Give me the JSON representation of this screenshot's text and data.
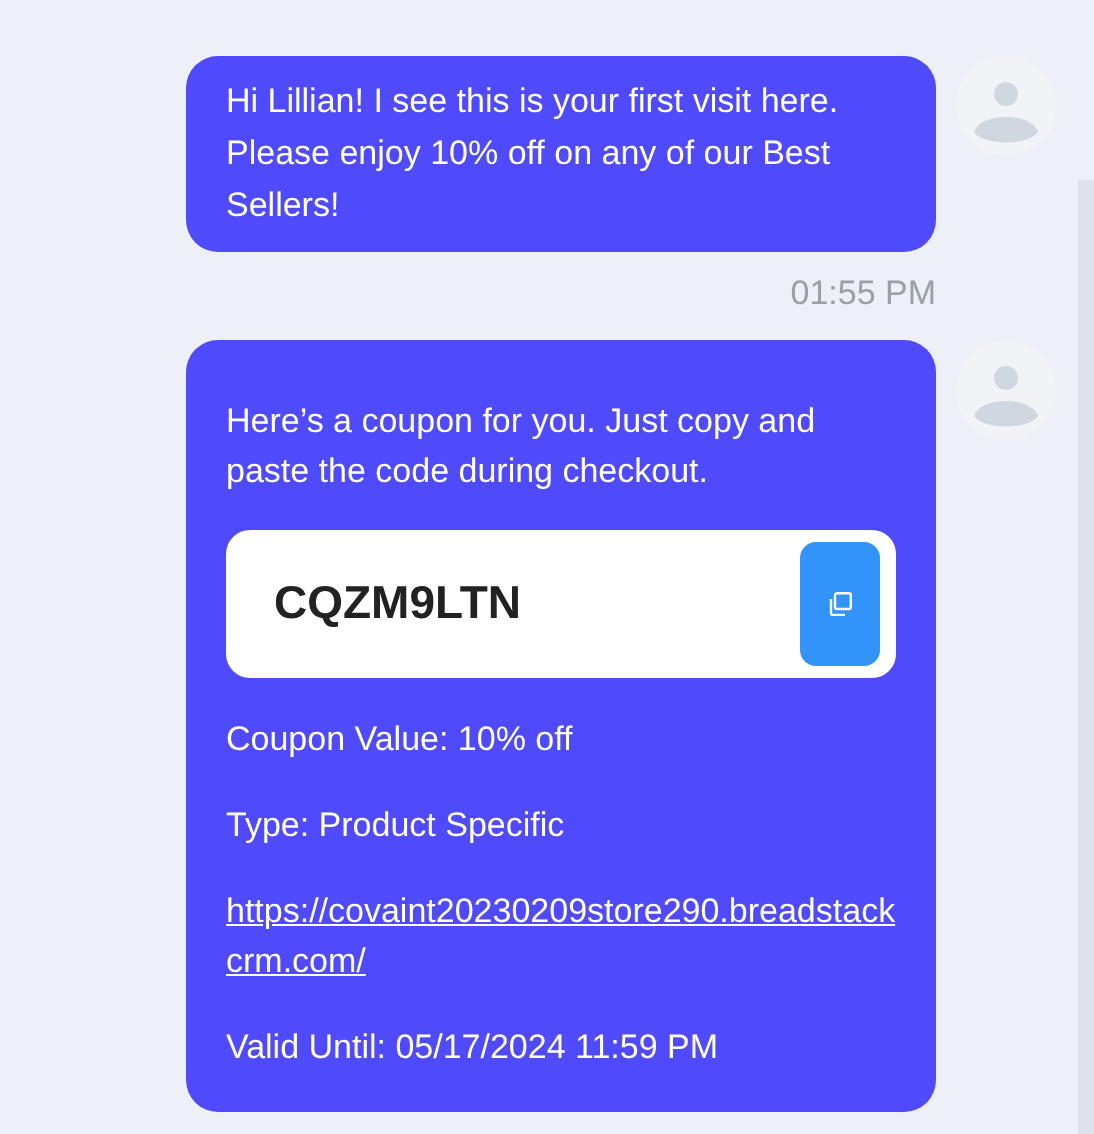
{
  "messages": [
    {
      "kind": "text",
      "text": "Hi Lillian! I see this is your first visit here. Please enjoy 10% off on any of our Best Sellers!"
    },
    {
      "kind": "coupon",
      "intro": "Here’s a coupon for you. Just copy and paste the code during checkout.",
      "code": "CQZM9LTN",
      "value": "Coupon Value: 10% off",
      "type": "Type: Product Specific",
      "link": "https://covaint20230209store290.breadstackcrm.com/",
      "valid": "Valid Until: 05/17/2024 11:59 PM"
    }
  ],
  "timestamp": "01:55 PM"
}
